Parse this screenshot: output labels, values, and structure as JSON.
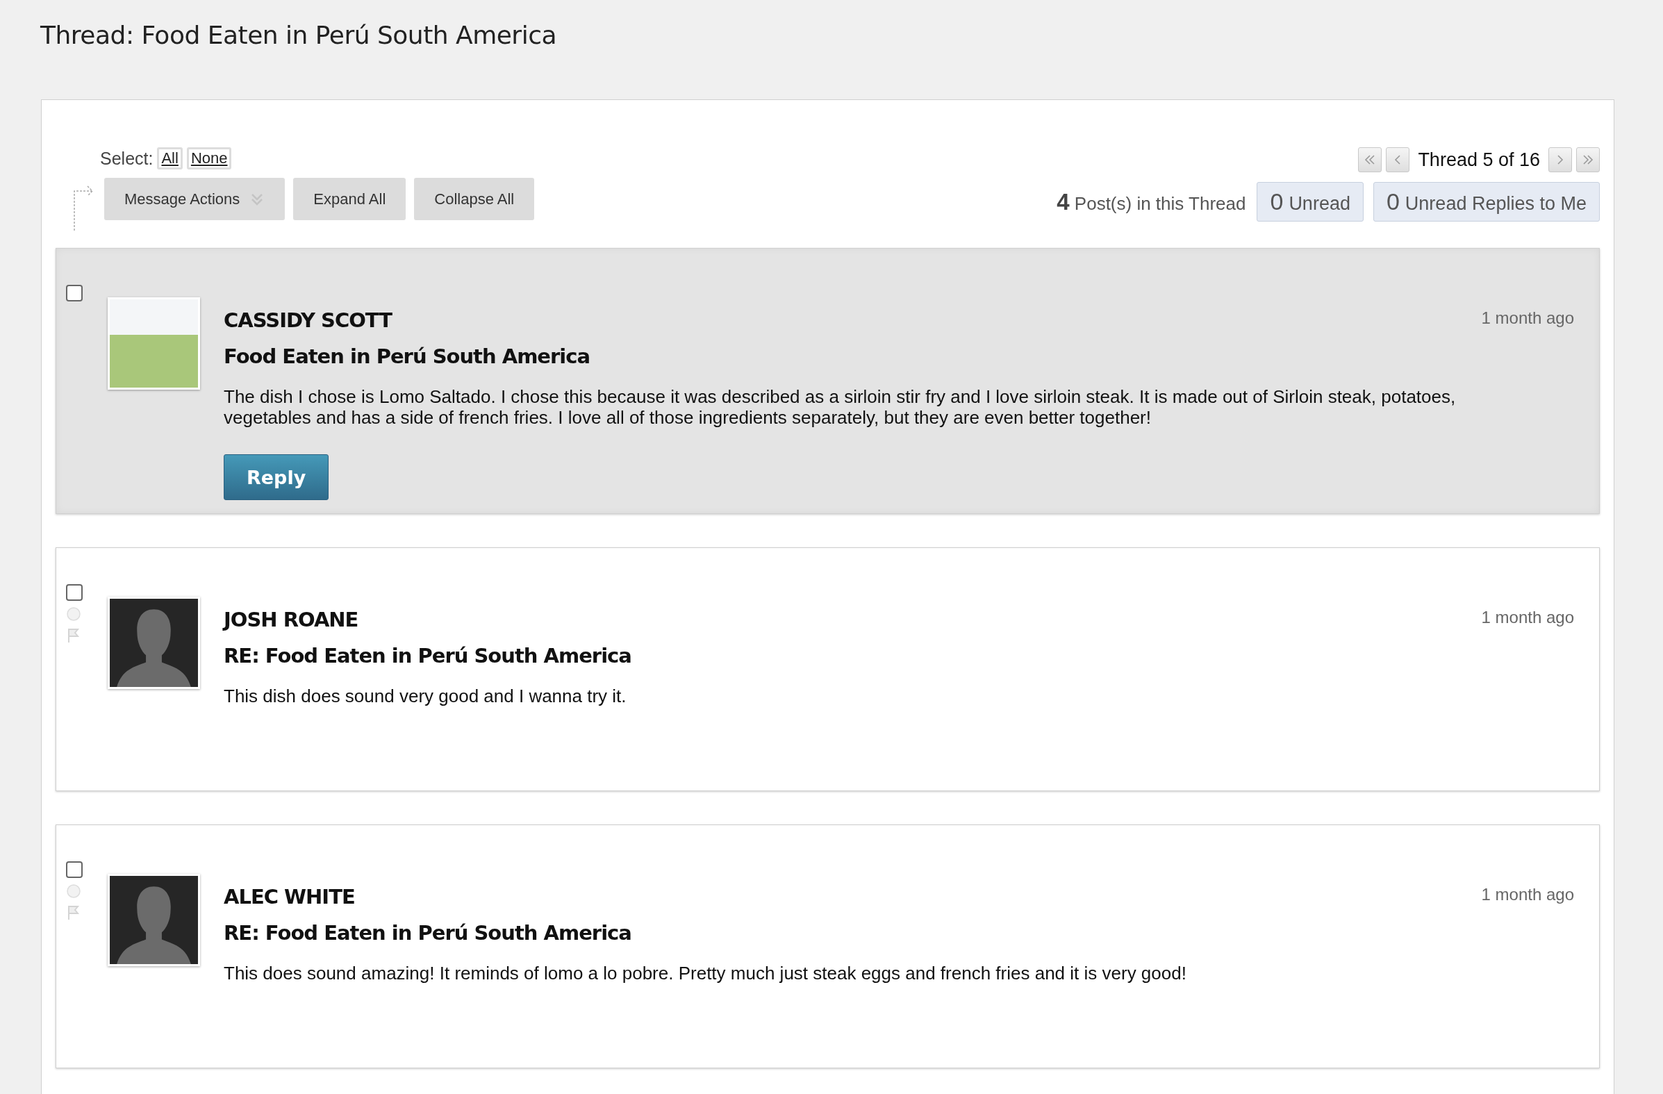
{
  "page_title": "Thread: Food Eaten in Perú South America",
  "toolbar": {
    "select_label": "Select:",
    "select_links": [
      "All",
      "None"
    ],
    "buttons": [
      {
        "label": "Message Actions",
        "kind": "menu"
      },
      {
        "label": "Expand All",
        "kind": "plain"
      },
      {
        "label": "Collapse All",
        "kind": "plain"
      }
    ]
  },
  "pager": {
    "label": "Thread 5 of 16"
  },
  "counts": [
    {
      "number": "4",
      "label": "Post(s) in this Thread",
      "kind": "text"
    },
    {
      "number": "0",
      "label": "Unread",
      "kind": "box"
    },
    {
      "number": "0",
      "label": "Unread Replies to Me",
      "kind": "box"
    }
  ],
  "posts": [
    {
      "kind": "original",
      "highlighted": true,
      "checked": false,
      "has_photo": true,
      "author": "CASSIDY SCOTT",
      "time": "1 month ago",
      "subject": "Food Eaten in Perú South America",
      "body": "The dish I chose is Lomo Saltado. I chose this because it was described as a sirloin stir fry and I love sirloin steak. It is made out of Sirloin steak, potatoes, vegetables and has a side of french fries. I love all of those ingredients separately, but they are even better together!",
      "reply_button": "Reply"
    },
    {
      "kind": "reply",
      "highlighted": false,
      "checked": false,
      "has_photo": false,
      "author": "JOSH ROANE",
      "time": "1 month ago",
      "subject": "RE: Food Eaten in Perú South America",
      "body": "This dish does sound very good and I wanna try it."
    },
    {
      "kind": "reply",
      "highlighted": false,
      "checked": false,
      "has_photo": false,
      "author": "ALEC WHITE",
      "time": "1 month ago",
      "subject": "RE: Food Eaten in Perú South America",
      "body": "This does sound amazing! It reminds of lomo a lo pobre. Pretty much just steak eggs and french fries and it is very good!"
    }
  ]
}
